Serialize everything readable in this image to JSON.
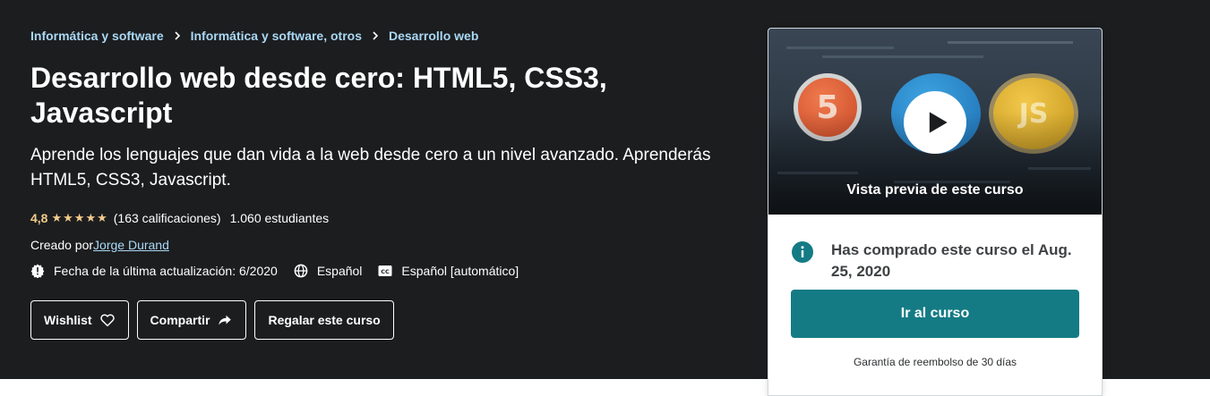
{
  "breadcrumb": {
    "items": [
      {
        "label": "Informática y software"
      },
      {
        "label": "Informática y software, otros"
      },
      {
        "label": "Desarrollo web"
      }
    ],
    "separator_icon": "chevron-right-icon"
  },
  "course": {
    "title": "Desarrollo web desde cero: HTML5, CSS3, Javascript",
    "subtitle": "Aprende los lenguajes que dan vida a la web desde cero a un nivel avanzado. Aprenderás HTML5, CSS3, Javascript.",
    "rating": "4,8",
    "stars": 5,
    "ratings_count": "(163 calificaciones)",
    "students": "1.060 estudiantes",
    "creator_label": "Creado por",
    "creator_name": "Jorge Durand",
    "last_updated": "Fecha de la última actualización: 6/2020",
    "language": "Español",
    "captions": "Español [automático]"
  },
  "actions": {
    "wishlist_label": "Wishlist",
    "share_label": "Compartir",
    "gift_label": "Regalar este curso"
  },
  "card": {
    "preview_label": "Vista previa de este curso",
    "purchased_text": "Has comprado este curso el Aug. 25, 2020",
    "go_to_course_label": "Ir al curso",
    "guarantee_text": "Garantía de reembolso de 30 días"
  },
  "colors": {
    "hero_bg": "#1c1d1f",
    "link": "#a9d8f5",
    "rating": "#f3ca8c",
    "primary": "#147b85",
    "info": "#147b85"
  }
}
